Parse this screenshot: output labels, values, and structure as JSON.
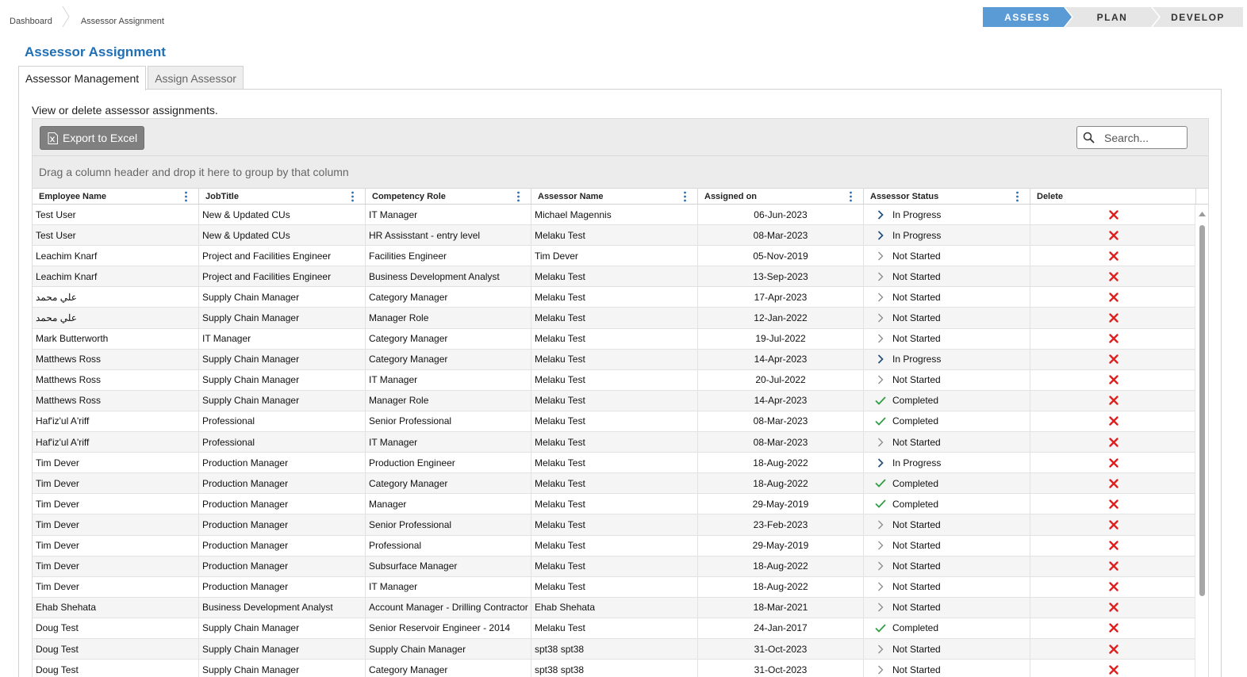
{
  "breadcrumb": {
    "items": [
      "Dashboard",
      "Assessor Assignment"
    ]
  },
  "steps": {
    "assess": "ASSESS",
    "plan": "PLAN",
    "develop": "DEVELOP",
    "active": "assess"
  },
  "page": {
    "title": "Assessor Assignment"
  },
  "tabs": {
    "management": "Assessor Management",
    "assign": "Assign Assessor"
  },
  "panel": {
    "description": "View or delete assessor assignments."
  },
  "toolbar": {
    "export_label": "Export to Excel",
    "search_placeholder": "Search..."
  },
  "group_hint": "Drag a column header and drop it here to group by that column",
  "columns": [
    "Employee Name",
    "JobTitle",
    "Competency Role",
    "Assessor Name",
    "Assigned on",
    "Assessor Status",
    "Delete"
  ],
  "colors": {
    "accent": "#5b9bd5",
    "title": "#1f6fb5",
    "completed": "#2e9e44",
    "in_progress": "#1f4e79",
    "delete": "#e02020"
  },
  "rows": [
    {
      "employee": "Test User",
      "job": "New & Updated CUs",
      "role": "IT Manager",
      "assessor": "Michael Magennis",
      "assigned": "06-Jun-2023",
      "status": "In Progress",
      "status_icon": "chevron-right-dark-icon"
    },
    {
      "employee": "Test User",
      "job": "New & Updated CUs",
      "role": "HR Assisstant - entry level",
      "assessor": "Melaku Test",
      "assigned": "08-Mar-2023",
      "status": "In Progress",
      "status_icon": "chevron-right-dark-icon"
    },
    {
      "employee": "Leachim Knarf",
      "job": "Project and Facilities Engineer",
      "role": "Facilities Engineer",
      "assessor": "Tim Dever",
      "assigned": "05-Nov-2019",
      "status": "Not Started",
      "status_icon": "chevron-right-icon"
    },
    {
      "employee": "Leachim Knarf",
      "job": "Project and Facilities Engineer",
      "role": "Business Development Analyst",
      "assessor": "Melaku Test",
      "assigned": "13-Sep-2023",
      "status": "Not Started",
      "status_icon": "chevron-right-icon"
    },
    {
      "employee": "علي محمد",
      "job": "Supply Chain Manager",
      "role": "Category Manager",
      "assessor": "Melaku Test",
      "assigned": "17-Apr-2023",
      "status": "Not Started",
      "status_icon": "chevron-right-icon"
    },
    {
      "employee": "علي محمد",
      "job": "Supply Chain Manager",
      "role": "Manager Role",
      "assessor": "Melaku Test",
      "assigned": "12-Jan-2022",
      "status": "Not Started",
      "status_icon": "chevron-right-icon"
    },
    {
      "employee": "Mark Butterworth",
      "job": "IT Manager",
      "role": "Category Manager",
      "assessor": "Melaku Test",
      "assigned": "19-Jul-2022",
      "status": "Not Started",
      "status_icon": "chevron-right-icon"
    },
    {
      "employee": "Matthews Ross",
      "job": "Supply Chain Manager",
      "role": "Category Manager",
      "assessor": "Melaku Test",
      "assigned": "14-Apr-2023",
      "status": "In Progress",
      "status_icon": "chevron-right-dark-icon"
    },
    {
      "employee": "Matthews Ross",
      "job": "Supply Chain Manager",
      "role": "IT Manager",
      "assessor": "Melaku Test",
      "assigned": "20-Jul-2022",
      "status": "Not Started",
      "status_icon": "chevron-right-icon"
    },
    {
      "employee": "Matthews Ross",
      "job": "Supply Chain Manager",
      "role": "Manager Role",
      "assessor": "Melaku Test",
      "assigned": "14-Apr-2023",
      "status": "Completed",
      "status_icon": "checkmark-icon"
    },
    {
      "employee": "Haf'iz'ul A'riff",
      "job": "Professional",
      "role": "Senior Professional",
      "assessor": "Melaku Test",
      "assigned": "08-Mar-2023",
      "status": "Completed",
      "status_icon": "checkmark-icon"
    },
    {
      "employee": "Haf'iz'ul A'riff",
      "job": "Professional",
      "role": "IT Manager",
      "assessor": "Melaku Test",
      "assigned": "08-Mar-2023",
      "status": "Not Started",
      "status_icon": "chevron-right-icon"
    },
    {
      "employee": "Tim Dever",
      "job": "Production Manager",
      "role": "Production Engineer",
      "assessor": "Melaku Test",
      "assigned": "18-Aug-2022",
      "status": "In Progress",
      "status_icon": "chevron-right-dark-icon"
    },
    {
      "employee": "Tim Dever",
      "job": "Production Manager",
      "role": "Category Manager",
      "assessor": "Melaku Test",
      "assigned": "18-Aug-2022",
      "status": "Completed",
      "status_icon": "checkmark-icon"
    },
    {
      "employee": "Tim Dever",
      "job": "Production Manager",
      "role": "Manager",
      "assessor": "Melaku Test",
      "assigned": "29-May-2019",
      "status": "Completed",
      "status_icon": "checkmark-icon"
    },
    {
      "employee": "Tim Dever",
      "job": "Production Manager",
      "role": "Senior Professional",
      "assessor": "Melaku Test",
      "assigned": "23-Feb-2023",
      "status": "Not Started",
      "status_icon": "chevron-right-icon"
    },
    {
      "employee": "Tim Dever",
      "job": "Production Manager",
      "role": "Professional",
      "assessor": "Melaku Test",
      "assigned": "29-May-2019",
      "status": "Not Started",
      "status_icon": "chevron-right-icon"
    },
    {
      "employee": "Tim Dever",
      "job": "Production Manager",
      "role": "Subsurface Manager",
      "assessor": "Melaku Test",
      "assigned": "18-Aug-2022",
      "status": "Not Started",
      "status_icon": "chevron-right-icon"
    },
    {
      "employee": "Tim Dever",
      "job": "Production Manager",
      "role": "IT Manager",
      "assessor": "Melaku Test",
      "assigned": "18-Aug-2022",
      "status": "Not Started",
      "status_icon": "chevron-right-icon"
    },
    {
      "employee": "Ehab Shehata",
      "job": "Business Development Analyst",
      "role": "Account Manager - Drilling Contractor",
      "assessor": "Ehab Shehata",
      "assigned": "18-Mar-2021",
      "status": "Not Started",
      "status_icon": "chevron-right-icon"
    },
    {
      "employee": "Doug Test",
      "job": "Supply Chain Manager",
      "role": "Senior Reservoir Engineer - 2014",
      "assessor": "Melaku Test",
      "assigned": "24-Jan-2017",
      "status": "Completed",
      "status_icon": "checkmark-icon"
    },
    {
      "employee": "Doug Test",
      "job": "Supply Chain Manager",
      "role": "Supply Chain Manager",
      "assessor": "spt38 spt38",
      "assigned": "31-Oct-2023",
      "status": "Not Started",
      "status_icon": "chevron-right-icon"
    },
    {
      "employee": "Doug Test",
      "job": "Supply Chain Manager",
      "role": "Category Manager",
      "assessor": "spt38 spt38",
      "assigned": "31-Oct-2023",
      "status": "Not Started",
      "status_icon": "chevron-right-icon"
    }
  ]
}
